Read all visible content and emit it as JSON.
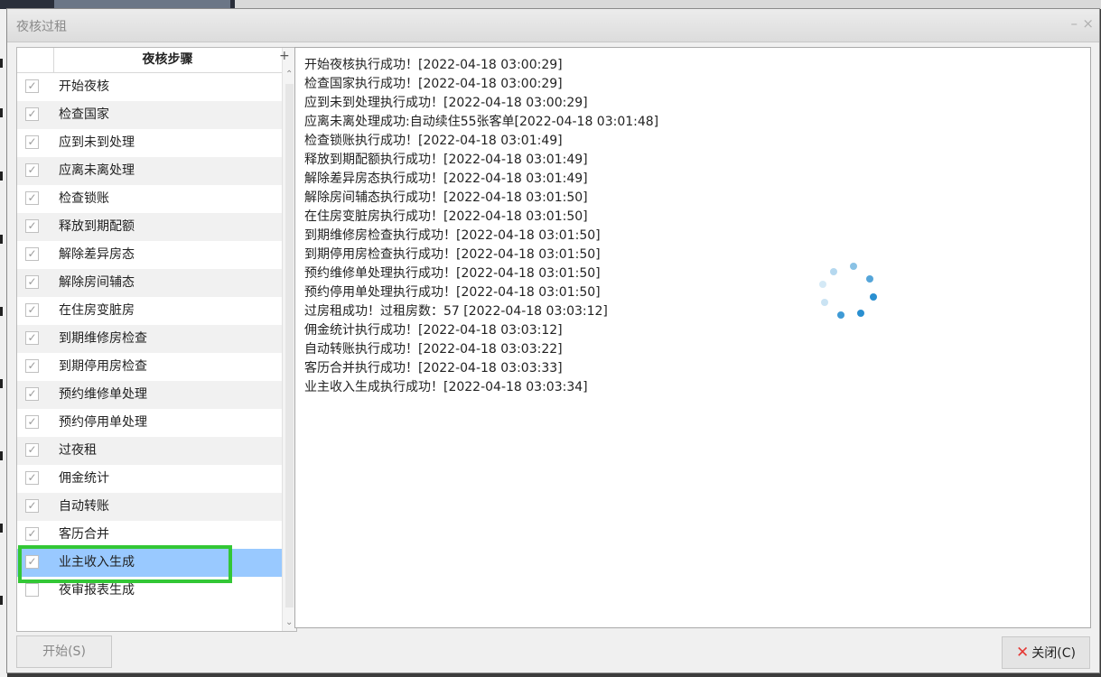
{
  "window": {
    "title": "夜核过租"
  },
  "steps": {
    "header": "夜核步骤",
    "items": [
      {
        "label": "开始夜核",
        "checked": true
      },
      {
        "label": "检查国家",
        "checked": true
      },
      {
        "label": "应到未到处理",
        "checked": true
      },
      {
        "label": "应离未离处理",
        "checked": true
      },
      {
        "label": "检查锁账",
        "checked": true
      },
      {
        "label": "释放到期配额",
        "checked": true
      },
      {
        "label": "解除差异房态",
        "checked": true
      },
      {
        "label": "解除房间辅态",
        "checked": true
      },
      {
        "label": "在住房变脏房",
        "checked": true
      },
      {
        "label": "到期维修房检查",
        "checked": true
      },
      {
        "label": "到期停用房检查",
        "checked": true
      },
      {
        "label": "预约维修单处理",
        "checked": true
      },
      {
        "label": "预约停用单处理",
        "checked": true
      },
      {
        "label": "过夜租",
        "checked": true
      },
      {
        "label": "佣金统计",
        "checked": true
      },
      {
        "label": "自动转账",
        "checked": true
      },
      {
        "label": "客历合并",
        "checked": true
      },
      {
        "label": "业主收入生成",
        "checked": true,
        "selected": true
      },
      {
        "label": "夜审报表生成",
        "checked": false
      }
    ]
  },
  "log": [
    "开始夜核执行成功！[2022-04-18 03:00:29]",
    "检查国家执行成功！[2022-04-18 03:00:29]",
    "应到未到处理执行成功！[2022-04-18 03:00:29]",
    "应离未离处理成功:自动续住55张客单[2022-04-18 03:01:48]",
    "检查锁账执行成功！[2022-04-18 03:01:49]",
    "释放到期配额执行成功！[2022-04-18 03:01:49]",
    "解除差异房态执行成功！[2022-04-18 03:01:49]",
    "解除房间辅态执行成功！[2022-04-18 03:01:50]",
    "在住房变脏房执行成功！[2022-04-18 03:01:50]",
    "到期维修房检查执行成功！[2022-04-18 03:01:50]",
    "到期停用房检查执行成功！[2022-04-18 03:01:50]",
    "预约维修单处理执行成功！[2022-04-18 03:01:50]",
    "预约停用单处理执行成功！[2022-04-18 03:01:50]",
    "过房租成功！过租房数：57 [2022-04-18 03:03:12]",
    "佣金统计执行成功！[2022-04-18 03:03:12]",
    "自动转账执行成功！[2022-04-18 03:03:22]",
    "客历合并执行成功！[2022-04-18 03:03:33]",
    "业主收入生成执行成功！[2022-04-18 03:03:34]"
  ],
  "buttons": {
    "start": "开始(S)",
    "close": "关闭(C)"
  },
  "colors": {
    "selected_row": "#99c9ff",
    "highlight_border": "#33c736",
    "spinner": "#2a8fd0",
    "close_icon": "#e53935"
  }
}
